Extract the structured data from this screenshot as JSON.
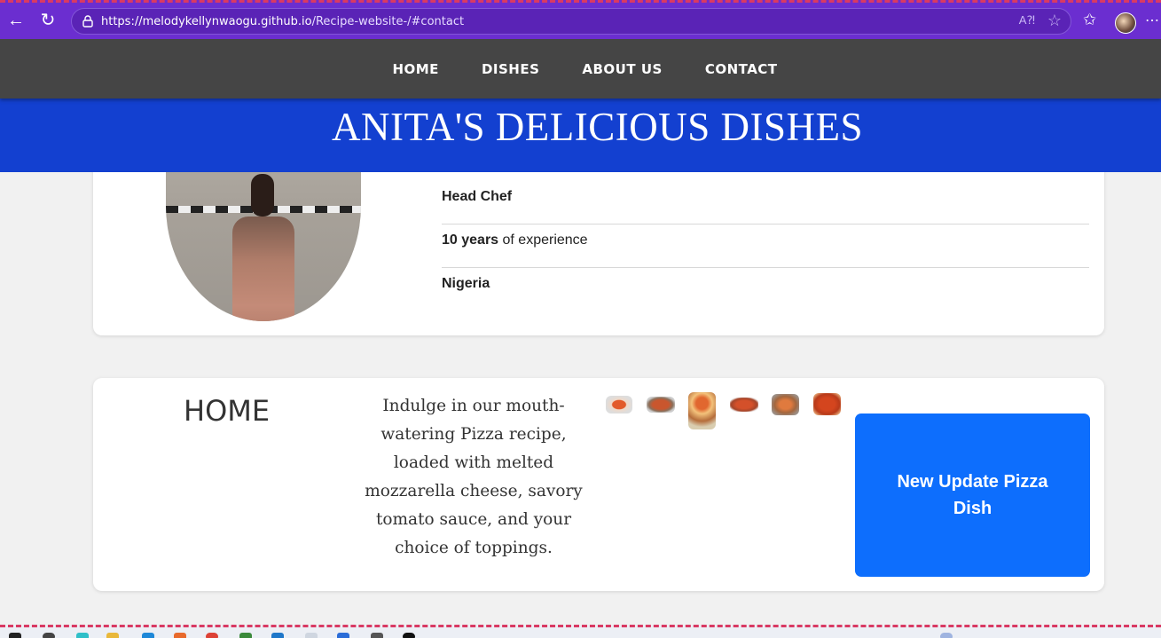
{
  "browser": {
    "url_host": "https://melodykellynwaogu.github.io",
    "url_path": "/Recipe-website-/#contact"
  },
  "nav": {
    "items": [
      "HOME",
      "DISHES",
      "ABOUT US",
      "CONTACT"
    ]
  },
  "banner": {
    "title": "ANITA'S DELICIOUS DISHES"
  },
  "profile": {
    "role": "Head Chef",
    "experience_bold": "10 years",
    "experience_rest": " of experience",
    "location": "Nigeria"
  },
  "home": {
    "title": "HOME",
    "description": "Indulge in our mouth-watering Pizza recipe, loaded with melted mozzarella cheese, savory tomato sauce, and your choice of toppings.",
    "button_label": "New Update Pizza Dish",
    "thumbnails": [
      "pizza-thumb-1",
      "pizza-thumb-2",
      "pizza-thumb-3",
      "pizza-thumb-4",
      "pizza-thumb-5",
      "pizza-thumb-6"
    ]
  },
  "colors": {
    "chrome": "#6b2ed0",
    "nav_bg": "#454545",
    "banner_bg": "#1340d0",
    "button_bg": "#0d6efd"
  }
}
